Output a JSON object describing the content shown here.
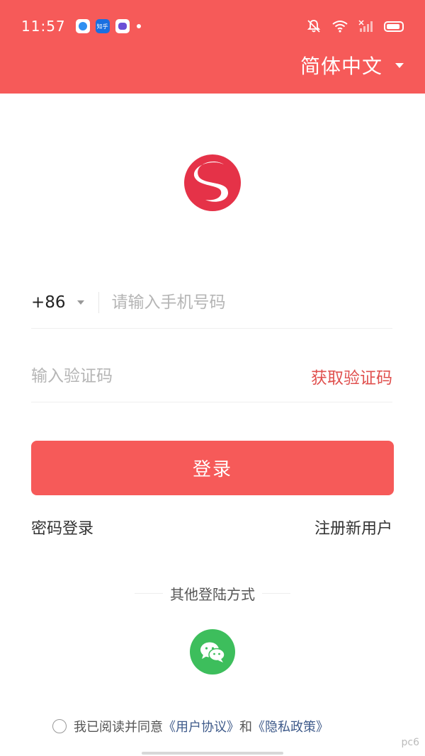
{
  "status_bar": {
    "time": "11:57",
    "zhihu_label": "知乎"
  },
  "header": {
    "language": "简体中文"
  },
  "form": {
    "country_code": "+86",
    "phone_placeholder": "请输入手机号码",
    "code_placeholder": "输入验证码",
    "get_code_label": "获取验证码",
    "login_label": "登录",
    "password_login_label": "密码登录",
    "register_label": "注册新用户"
  },
  "other_login": {
    "title": "其他登陆方式",
    "wechat_icon": "wechat-icon"
  },
  "agreement": {
    "prefix": "我已阅读并同意",
    "user_agreement": "《用户协议》",
    "conjunction": "和",
    "privacy_policy": "《隐私政策》"
  },
  "watermark": "pc6",
  "colors": {
    "brand": "#f65a59",
    "link": "#e0514f",
    "wechat": "#3dbe5c"
  }
}
